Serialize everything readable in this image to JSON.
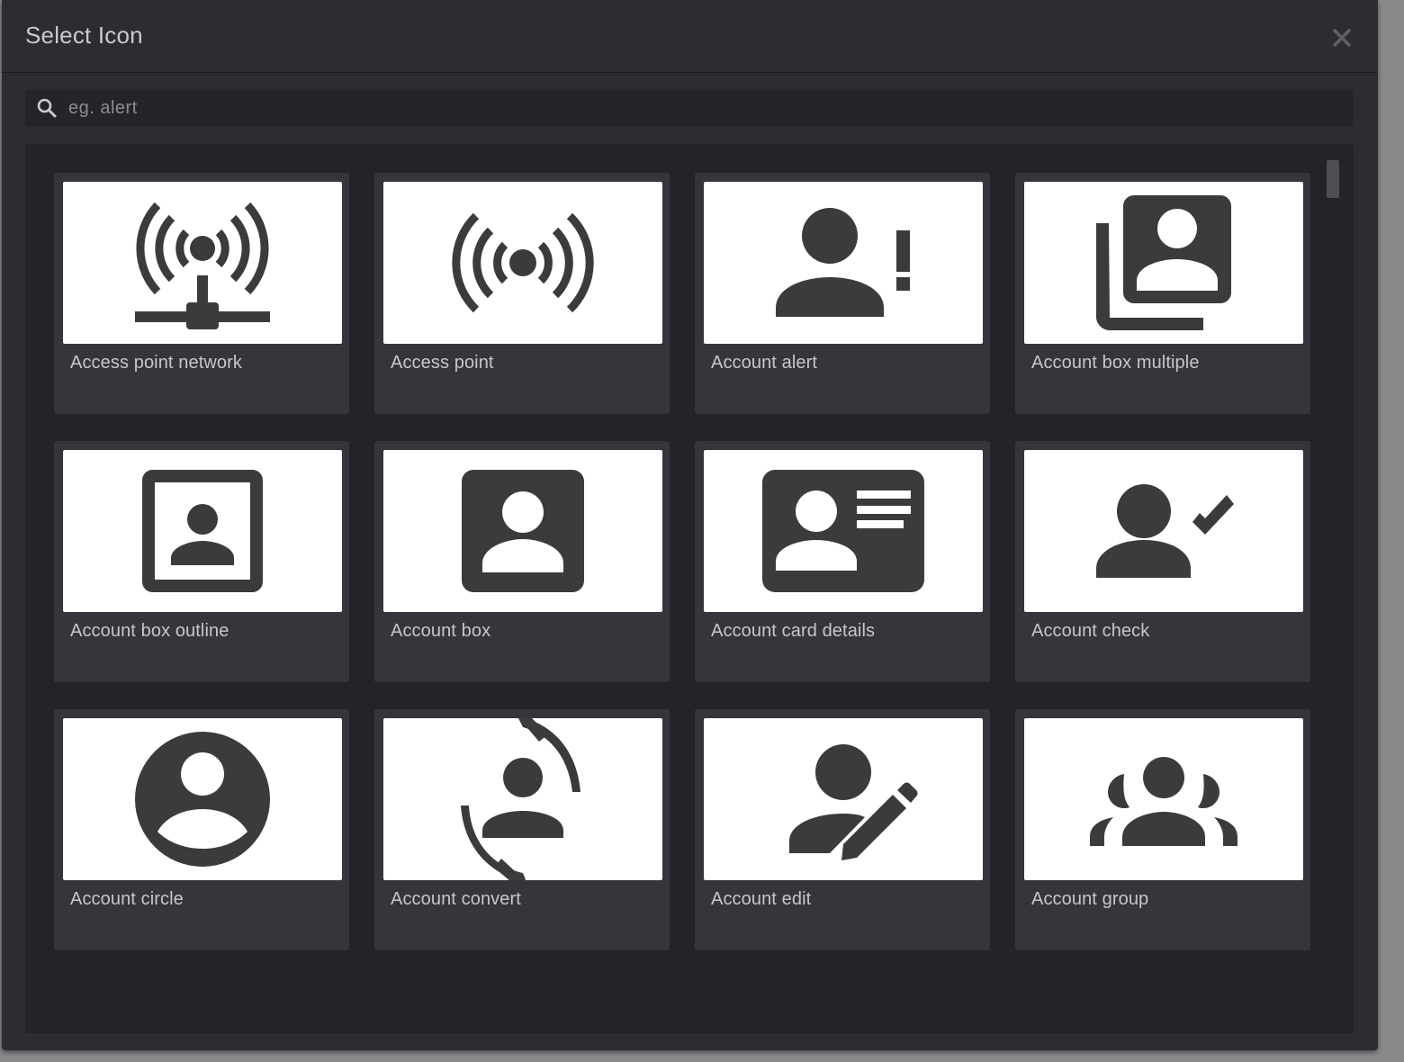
{
  "dialog": {
    "title": "Select Icon",
    "close_icon": "close-icon"
  },
  "search": {
    "placeholder": "eg. alert",
    "value": "",
    "icon": "search-icon"
  },
  "colors": {
    "modal_bg": "#2b2d33",
    "panel_bg": "#23242a",
    "card_bg": "#34363c",
    "icon_fill": "#3b3b3d",
    "text": "#c6c7ca"
  },
  "icons": [
    {
      "label": "Access point network",
      "icon": "access-point-network-icon"
    },
    {
      "label": "Access point",
      "icon": "access-point-icon"
    },
    {
      "label": "Account alert",
      "icon": "account-alert-icon"
    },
    {
      "label": "Account box multiple",
      "icon": "account-box-multiple-icon"
    },
    {
      "label": "Account box outline",
      "icon": "account-box-outline-icon"
    },
    {
      "label": "Account box",
      "icon": "account-box-icon"
    },
    {
      "label": "Account card details",
      "icon": "account-card-details-icon"
    },
    {
      "label": "Account check",
      "icon": "account-check-icon"
    },
    {
      "label": "Account circle",
      "icon": "account-circle-icon"
    },
    {
      "label": "Account convert",
      "icon": "account-convert-icon"
    },
    {
      "label": "Account edit",
      "icon": "account-edit-icon"
    },
    {
      "label": "Account group",
      "icon": "account-group-icon"
    }
  ]
}
